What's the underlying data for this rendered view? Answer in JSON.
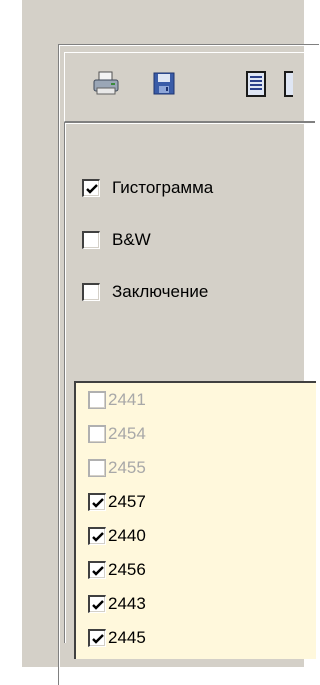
{
  "toolbar": {
    "icons": [
      "printer-icon",
      "save-disk-icon",
      "document-view-icon"
    ]
  },
  "options": [
    {
      "label": "Гистограмма",
      "checked": true
    },
    {
      "label": "B&W",
      "checked": false
    },
    {
      "label": "Заключение",
      "checked": false
    }
  ],
  "list": {
    "items": [
      {
        "label": "2441",
        "checked": false,
        "enabled": false
      },
      {
        "label": "2454",
        "checked": false,
        "enabled": false
      },
      {
        "label": "2455",
        "checked": false,
        "enabled": false
      },
      {
        "label": "2457",
        "checked": true,
        "enabled": true
      },
      {
        "label": "2440",
        "checked": true,
        "enabled": true
      },
      {
        "label": "2456",
        "checked": true,
        "enabled": true
      },
      {
        "label": "2443",
        "checked": true,
        "enabled": true
      },
      {
        "label": "2445",
        "checked": true,
        "enabled": true
      }
    ]
  },
  "colors": {
    "window": "#d4d0c8",
    "list_bg": "#fff8dc",
    "disabled_text": "#a8a8a8"
  }
}
